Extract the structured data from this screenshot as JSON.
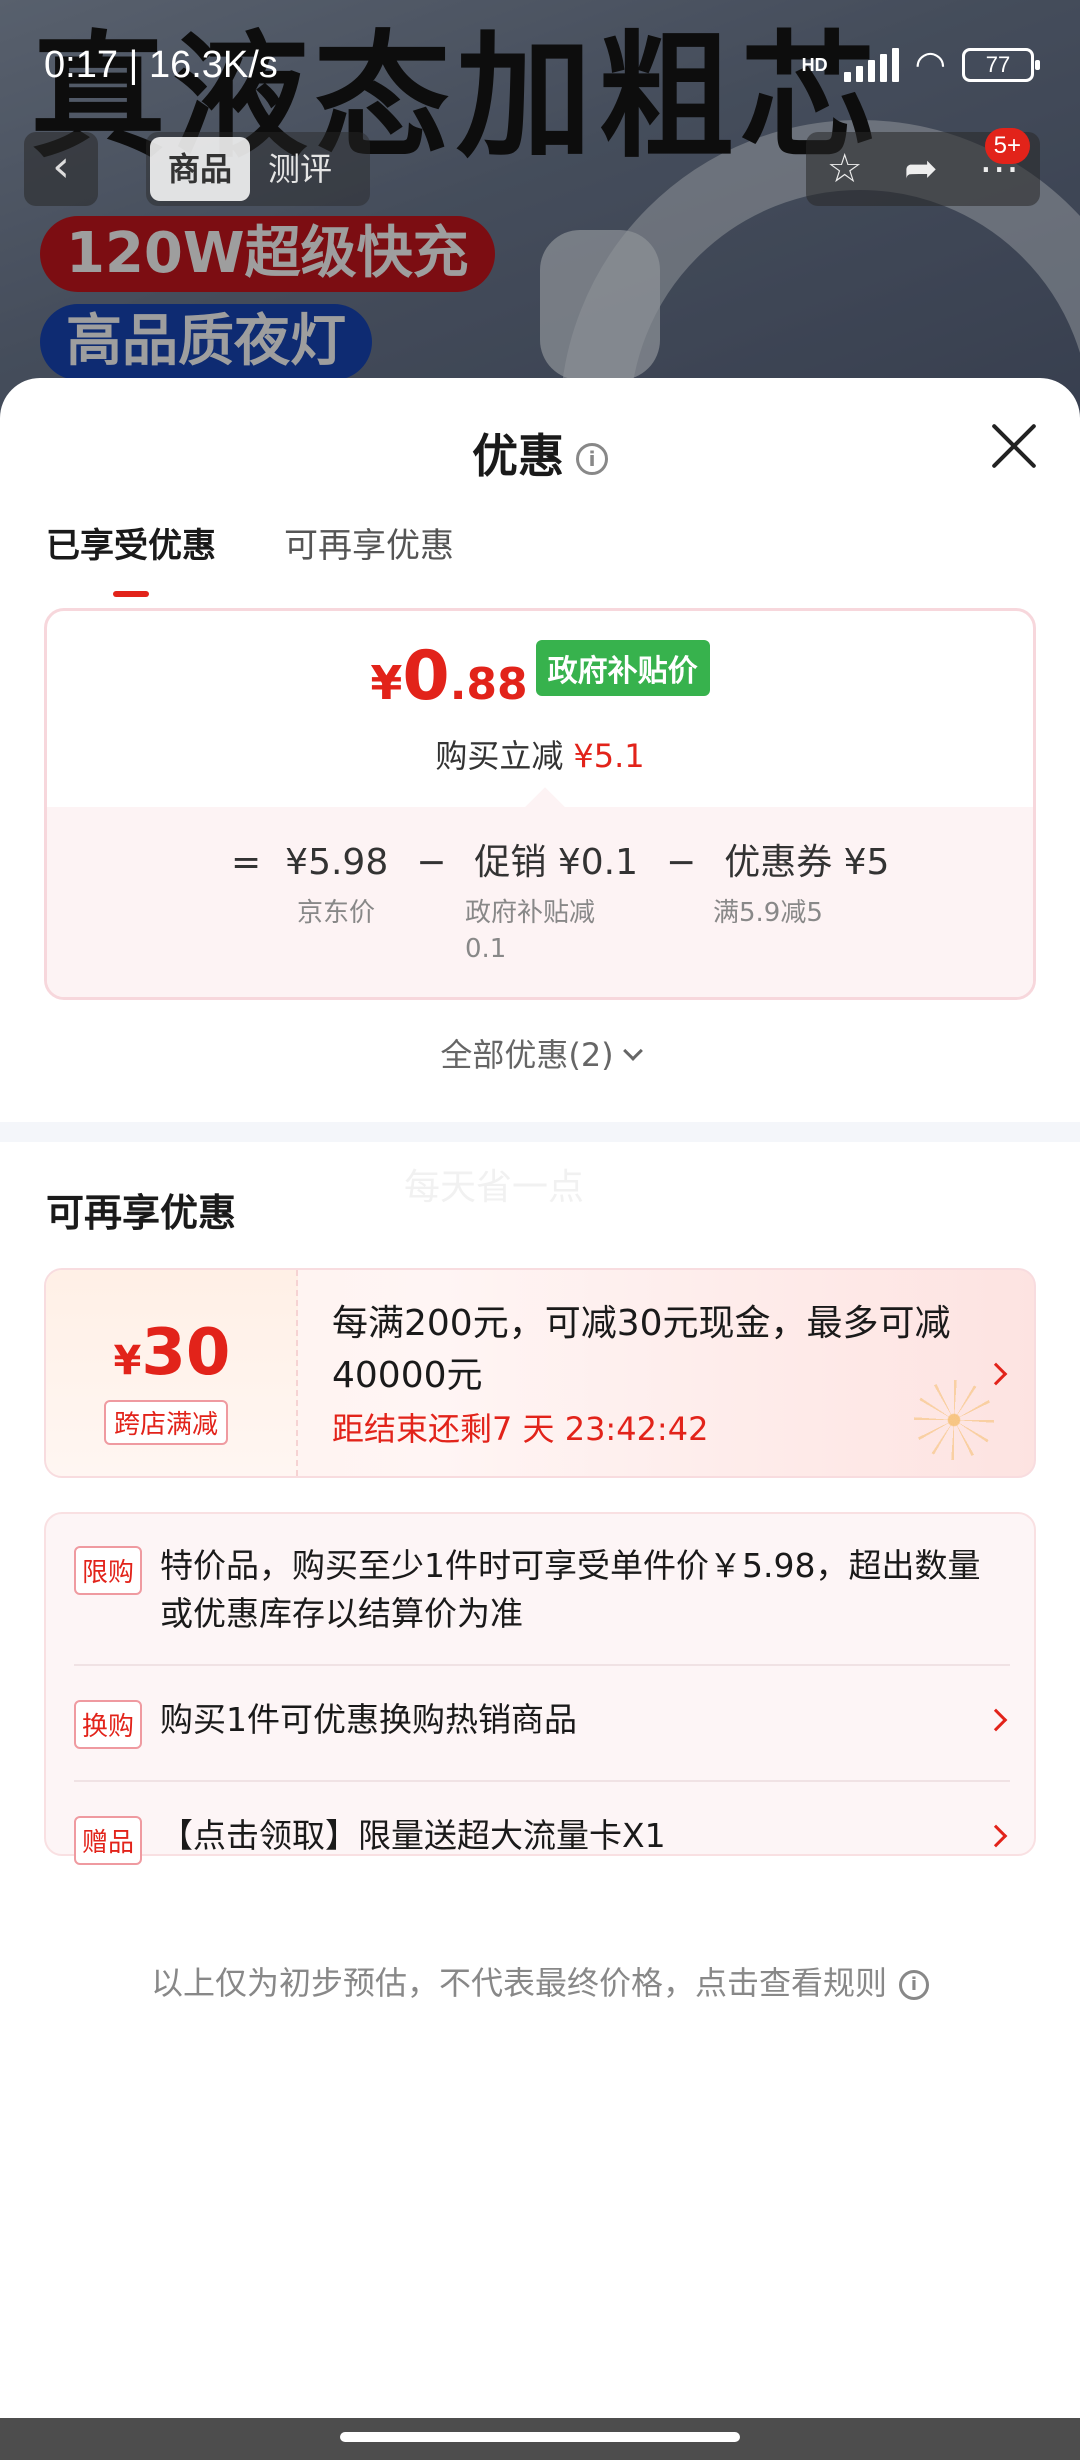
{
  "status_bar": {
    "time": "0:17 | 16.3K/s",
    "network": "HD",
    "battery": "77"
  },
  "background_page": {
    "headline": "真液态加粗芯",
    "pill_red": "120W超级快充",
    "pill_blue": "高品质夜灯",
    "nav_tabs": [
      "商品",
      "测评"
    ],
    "notification_badge": "5+"
  },
  "sheet": {
    "title": "优惠",
    "tabs": [
      "已享受优惠",
      "可再享优惠"
    ],
    "price_card": {
      "final_price": {
        "currency": "¥",
        "integer": "0",
        "decimal": ".88"
      },
      "subsidy_tag": "政府补贴价",
      "reduce_label": "购买立减",
      "reduce_amount": "¥5.1",
      "equation": {
        "equals": "=",
        "jd_price": "¥5.98",
        "jd_price_label": "京东价",
        "minus1": "−",
        "promo": "促销 ¥0.1",
        "promo_label": "政府补贴减\n0.1",
        "minus2": "−",
        "coupon": "优惠券 ¥5",
        "coupon_label": "满5.9减5"
      }
    },
    "all_discounts": "全部优惠(2)",
    "watermark": "每天省一点",
    "more_section_title": "可再享优惠",
    "coupon": {
      "currency": "¥",
      "amount": "30",
      "type": "跨店满减",
      "description": "每满200元，可减30元现金，最多可减40000元",
      "countdown": "距结束还剩7 天 23:42:42"
    },
    "promotions": [
      {
        "tag": "限购",
        "text": "特价品，购买至少1件时可享受单件价￥5.98，超出数量或优惠库存以结算价为准"
      },
      {
        "tag": "换购",
        "text": "购买1件可优惠换购热销商品"
      },
      {
        "tag": "赠品",
        "text": "【点击领取】限量送超大流量卡X1"
      }
    ],
    "footnote": "以上仅为初步预估，不代表最终价格，点击查看规则"
  },
  "colors": {
    "accent": "#e2231a",
    "subsidy_green": "#37b24d"
  }
}
